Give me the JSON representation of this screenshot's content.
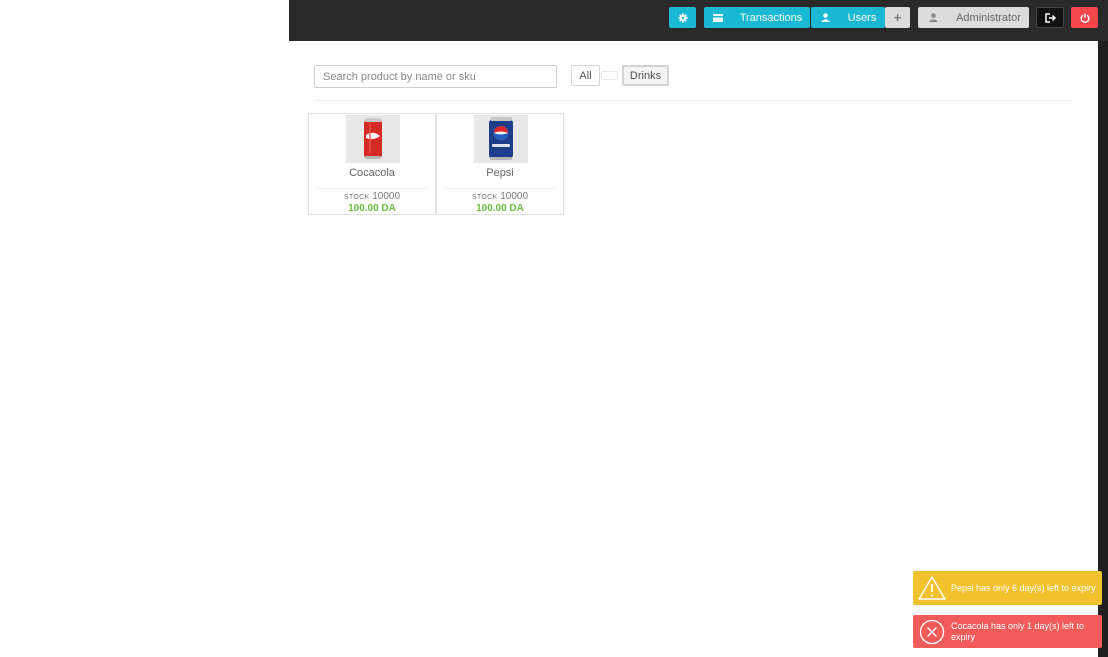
{
  "toolbar": {
    "transactions_label": "Transactions",
    "users_label": "Users",
    "add_label": "+",
    "user_name": "Administrator"
  },
  "search": {
    "placeholder": "Search product by name or sku",
    "value": ""
  },
  "categories": [
    {
      "label": "All",
      "active": false
    },
    {
      "label": "",
      "active": false
    },
    {
      "label": "Drinks",
      "active": true
    }
  ],
  "products": [
    {
      "name": "Cocacola",
      "stock_label": "STOCK",
      "stock": "10000",
      "price": "100.00 DA",
      "image": "coca-cola-can"
    },
    {
      "name": "Pepsi",
      "stock_label": "STOCK",
      "stock": "10000",
      "price": "100.00 DA",
      "image": "pepsi-can"
    }
  ],
  "notifications": [
    {
      "type": "warning",
      "icon": "warning-icon",
      "text": "Pepsi has only 6 day(s) left to expiry"
    },
    {
      "type": "error",
      "icon": "error-icon",
      "text": "Cocacola has only 1 day(s) left to expiry"
    }
  ],
  "colors": {
    "accent": "#1ab8d3",
    "danger": "#f3474b",
    "price": "#6abf3e",
    "warning": "#f2c12e",
    "error": "#f25b5b"
  }
}
